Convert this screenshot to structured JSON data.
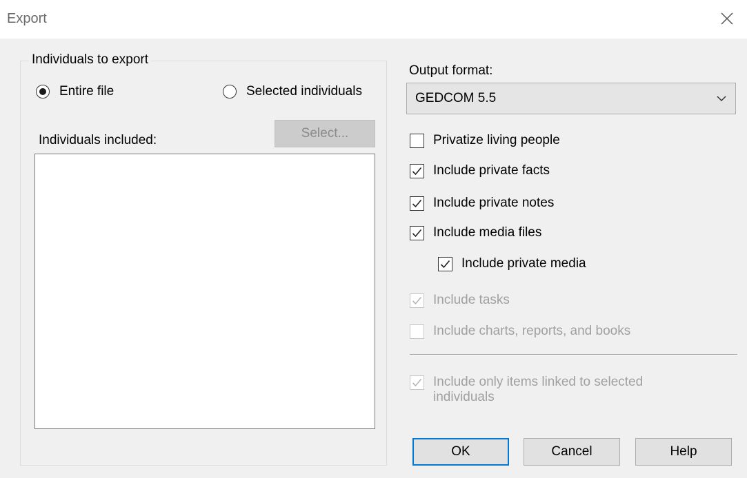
{
  "window": {
    "title": "Export"
  },
  "individuals": {
    "legend": "Individuals to export",
    "entire_file_label": "Entire file",
    "entire_file_selected": true,
    "selected_individuals_label": "Selected individuals",
    "included_label": "Individuals included:",
    "select_button_label": "Select...",
    "list_items": []
  },
  "output": {
    "label": "Output format:",
    "selected_format": "GEDCOM 5.5"
  },
  "options": [
    {
      "label": "Privatize living people",
      "checked": false,
      "enabled": true
    },
    {
      "label": "Include private facts",
      "checked": true,
      "enabled": true
    },
    {
      "label": "Include private notes",
      "checked": true,
      "enabled": true
    },
    {
      "label": "Include media files",
      "checked": true,
      "enabled": true
    },
    {
      "label": "Include private media",
      "checked": true,
      "enabled": true
    },
    {
      "label": "Include tasks",
      "checked": true,
      "enabled": false
    },
    {
      "label": "Include charts, reports, and books",
      "checked": false,
      "enabled": false
    }
  ],
  "linked_option": {
    "label_line1": "Include only items linked  to selected",
    "label_line2": "individuals",
    "checked": true,
    "enabled": false
  },
  "buttons": {
    "ok": "OK",
    "cancel": "Cancel",
    "help": "Help"
  }
}
